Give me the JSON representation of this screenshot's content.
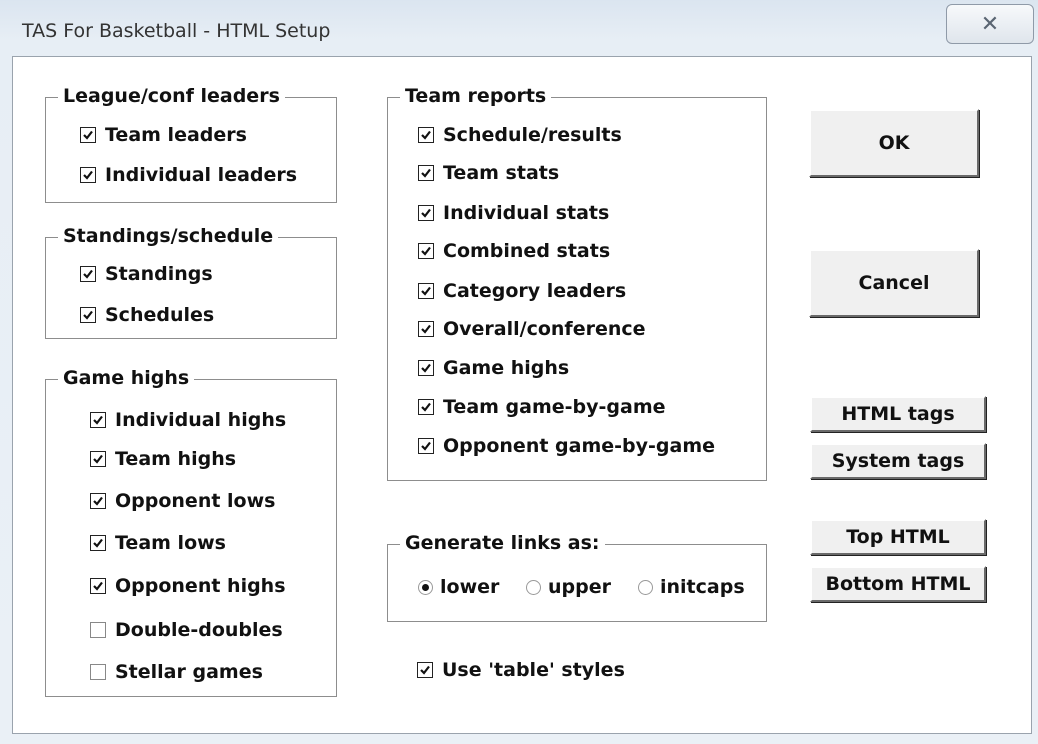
{
  "window": {
    "title": "TAS For Basketball - HTML Setup",
    "close_glyph": "✕"
  },
  "groups": {
    "league": {
      "title": "League/conf leaders",
      "items": [
        {
          "label": "Team leaders",
          "checked": true
        },
        {
          "label": "Individual leaders",
          "checked": true
        }
      ]
    },
    "standings": {
      "title": "Standings/schedule",
      "items": [
        {
          "label": "Standings",
          "checked": true
        },
        {
          "label": "Schedules",
          "checked": true
        }
      ]
    },
    "game_highs": {
      "title": "Game highs",
      "items": [
        {
          "label": "Individual highs",
          "checked": true
        },
        {
          "label": "Team highs",
          "checked": true
        },
        {
          "label": "Opponent lows",
          "checked": true
        },
        {
          "label": "Team lows",
          "checked": true
        },
        {
          "label": "Opponent highs",
          "checked": true
        },
        {
          "label": "Double-doubles",
          "checked": false
        },
        {
          "label": "Stellar games",
          "checked": false
        }
      ]
    },
    "team_reports": {
      "title": "Team reports",
      "items": [
        {
          "label": "Schedule/results",
          "checked": true
        },
        {
          "label": "Team stats",
          "checked": true
        },
        {
          "label": "Individual stats",
          "checked": true
        },
        {
          "label": "Combined stats",
          "checked": true
        },
        {
          "label": "Category leaders",
          "checked": true
        },
        {
          "label": "Overall/conference",
          "checked": true
        },
        {
          "label": "Game highs",
          "checked": true
        },
        {
          "label": "Team game-by-game",
          "checked": true
        },
        {
          "label": "Opponent game-by-game",
          "checked": true
        }
      ]
    },
    "links": {
      "title": "Generate links as:",
      "options": [
        {
          "label": "lower",
          "selected": true
        },
        {
          "label": "upper",
          "selected": false
        },
        {
          "label": "initcaps",
          "selected": false
        }
      ]
    }
  },
  "table_styles": {
    "label": "Use 'table' styles",
    "checked": true
  },
  "buttons": {
    "ok": "OK",
    "cancel": "Cancel",
    "html_tags": "HTML tags",
    "system_tags": "System tags",
    "top_html": "Top HTML",
    "bottom_html": "Bottom HTML"
  }
}
